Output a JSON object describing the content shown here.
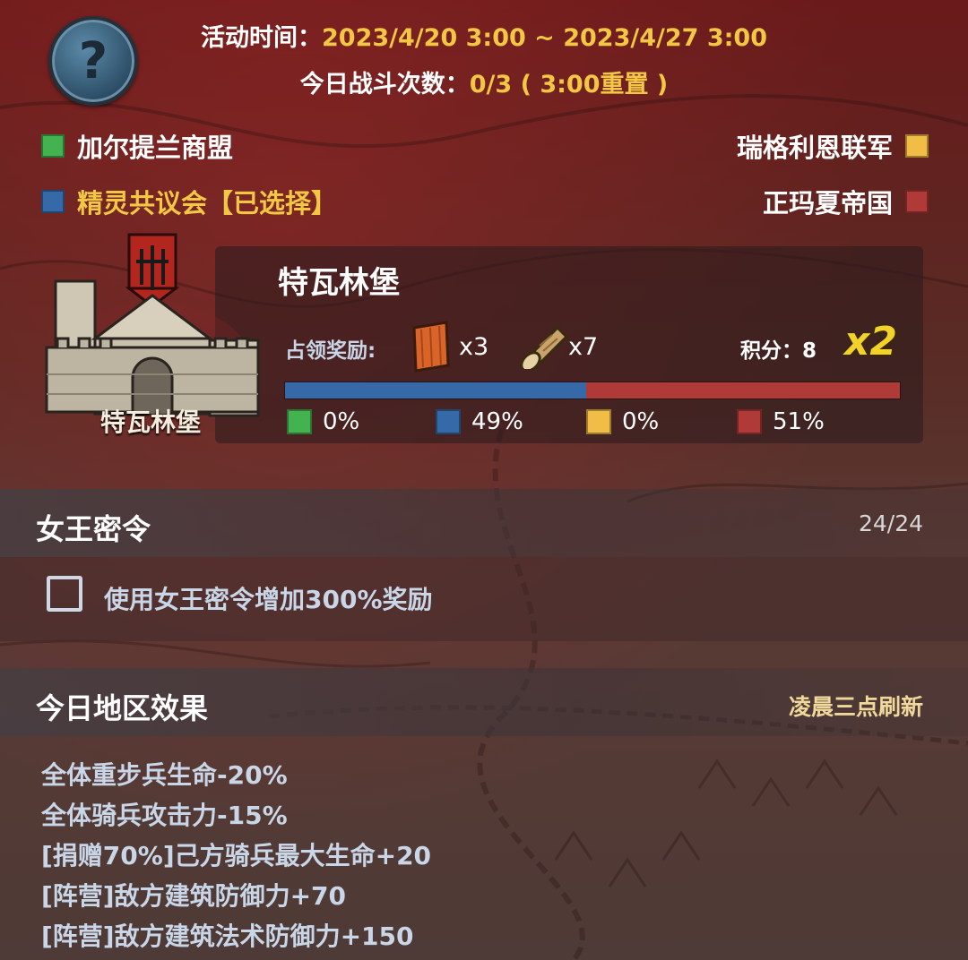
{
  "event": {
    "time_label": "活动时间：",
    "time_value": "2023/4/20 3:00 ~ 2023/4/27 3:00",
    "battle_label": "今日战斗次数：",
    "battle_value": "0/3 ( 3:00重置 )"
  },
  "help_icon": "question-mark-icon",
  "factions": [
    {
      "name": "加尔提兰商盟",
      "color": "#43b34f",
      "label_color": "#ffffff"
    },
    {
      "name": "精灵共议会【已选择】",
      "color": "#3569a8",
      "label_color": "#f2c744"
    },
    {
      "name": "瑞格利恩联军",
      "color": "#f1bd46",
      "label_color": "#ffffff"
    },
    {
      "name": "正玛夏帝国",
      "color": "#b03a38",
      "label_color": "#ffffff"
    }
  ],
  "castle": {
    "caption": "特瓦林堡",
    "title": "特瓦林堡",
    "reward_label": "占领奖励:",
    "rewards": [
      {
        "icon": "wood-plank-icon",
        "count": "x3"
      },
      {
        "icon": "log-icon",
        "count": "x7"
      }
    ],
    "score_label": "积分：8",
    "multiplier": "x2",
    "control_split": [
      {
        "color": "#43b34f",
        "percent": 0,
        "label": "0%"
      },
      {
        "color": "#3569a8",
        "percent": 49,
        "label": "49%"
      },
      {
        "color": "#f1bd46",
        "percent": 0,
        "label": "0%"
      },
      {
        "color": "#b03a38",
        "percent": 51,
        "label": "51%"
      }
    ]
  },
  "queen_order": {
    "title": "女王密令",
    "count": "24/24",
    "checkbox_label": "使用女王密令增加300%奖励",
    "checked": false
  },
  "region_effects": {
    "title": "今日地区效果",
    "refresh_note": "凌晨三点刷新",
    "items": [
      "全体重步兵生命-20%",
      "全体骑兵攻击力-15%",
      "[捐赠70%]己方骑兵最大生命+20",
      "[阵营]敌方建筑防御力+70",
      "[阵营]敌方建筑法术防御力+150"
    ]
  },
  "colors": {
    "accent_yellow": "#f2c744",
    "text_blue": "#c8d6e8"
  }
}
